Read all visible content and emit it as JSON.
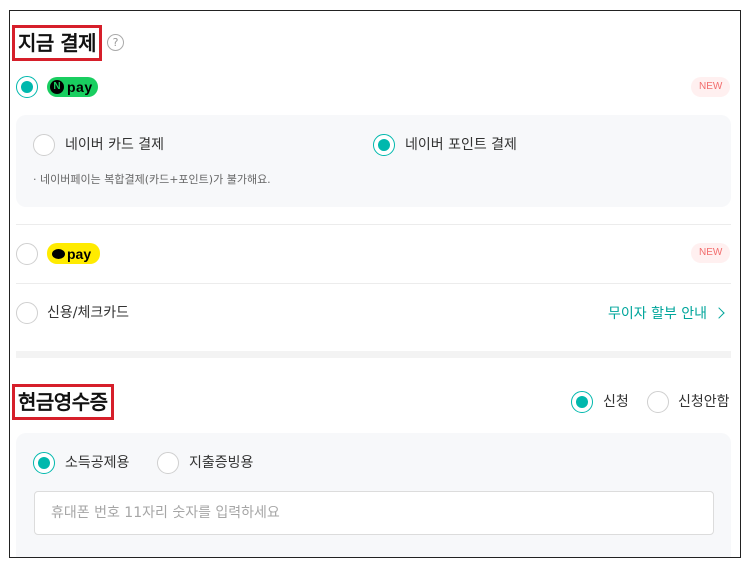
{
  "pay_now": {
    "title": "지금 결제",
    "help_icon_glyph": "?",
    "naver_pay": {
      "logo_n": "N",
      "logo_text": "pay",
      "badge": "NEW",
      "options": [
        "네이버 카드 결제",
        "네이버 포인트 결제"
      ],
      "selected_option": "네이버 포인트 결제",
      "note": "· 네이버페이는 복합결제(카드+포인트)가 불가해요."
    },
    "kakao_pay": {
      "logo_text": "pay",
      "badge": "NEW"
    },
    "credit_card": {
      "label": "신용/체크카드",
      "installment_link": "무이자 할부 안내"
    }
  },
  "cash_receipt": {
    "title": "현금영수증",
    "apply_options": [
      "신청",
      "신청안함"
    ],
    "selected_apply": "신청",
    "purpose_options": [
      "소득공제용",
      "지출증빙용"
    ],
    "selected_purpose": "소득공제용",
    "phone_input": {
      "value": "",
      "placeholder": "휴대폰 번호 11자리 숫자를 입력하세요"
    }
  },
  "colors": {
    "accent": "#00b8ad",
    "highlight_border": "#d61f2a",
    "naver_green": "#19ce60",
    "kakao_yellow": "#ffeb00",
    "badge_text": "#f26d6d"
  }
}
